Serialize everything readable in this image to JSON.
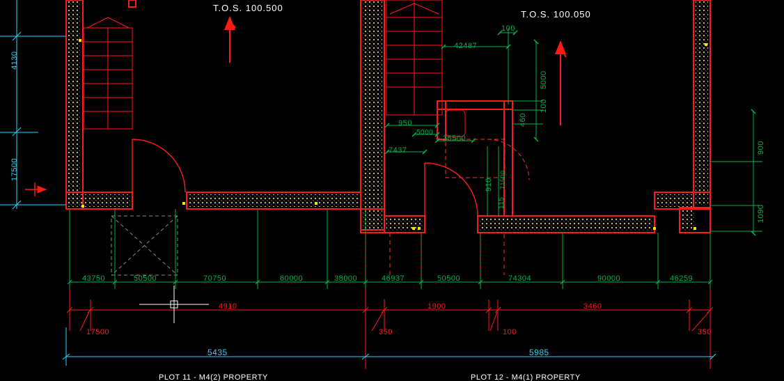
{
  "meta": {
    "drawing_type": "architectural_floor_plan",
    "application": "CAD",
    "background": "#000000"
  },
  "colors": {
    "wall_outline": "#ff1a1a",
    "dimension_primary": "#00b54a",
    "dimension_secondary": "#ff1a1a",
    "dimension_overall": "#29d5ff",
    "hatch": "#c7b18a",
    "text_white": "#ffffff",
    "dashed": "#ff3030"
  },
  "labels": {
    "tos_left": "T.O.S. 100.500",
    "tos_right": "T.O.S. 100.050",
    "plot_left": "PLOT 11 - M4(2) PROPERTY",
    "plot_right": "PLOT 12 - M4(1) PROPERTY"
  },
  "dimensions": {
    "left_vertical_axis": {
      "d1": "4130",
      "d2": "17500"
    },
    "right_vertical_axis": {
      "v1": "900",
      "v2": "1090"
    },
    "right_vertical_interior": {
      "v3": "5000",
      "v4": "100",
      "v5": "460"
    },
    "interior_small": {
      "a": "950",
      "b": "5000",
      "c": "35500",
      "d": "7437",
      "e": "100",
      "f": "42487",
      "g": "910",
      "h": "71500",
      "i": "115"
    },
    "horiz_row_green": {
      "d1": "43750",
      "d2": "50500",
      "d3": "70750",
      "d4": "60000",
      "d5": "38000",
      "d6": "46937",
      "d7": "50500",
      "d8": "74304",
      "d9": "90000",
      "d10": "46259"
    },
    "horiz_row_red": {
      "r1": "4910",
      "r2": "1900",
      "r3": "3460"
    },
    "horiz_row_red_small": {
      "s1": "17500",
      "s2": "350",
      "s3": "100",
      "s4": "350"
    },
    "horiz_row_cyan": {
      "c1": "5435",
      "c2": "5985"
    }
  }
}
